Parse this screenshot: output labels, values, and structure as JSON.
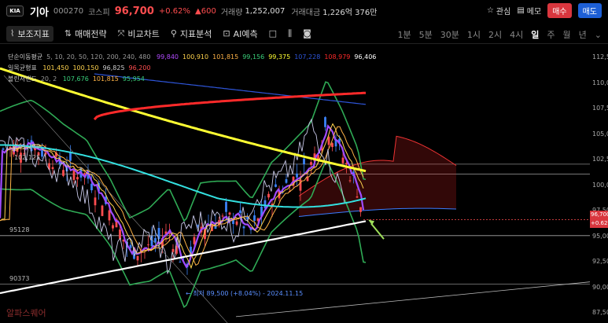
{
  "header": {
    "logo_text": "KIA",
    "name": "기아",
    "code": "000270",
    "market": "코스피",
    "price": "96,700",
    "change_pct": "+0.62%",
    "change_abs": "▲600",
    "volume_label": "거래량",
    "volume": "1,252,007",
    "amount_label": "거래대금",
    "amount": "1,226억 376만",
    "watch_label": "관심",
    "memo_label": "메모",
    "buy_label": "매수",
    "sell_label": "매도"
  },
  "toolbar": {
    "indicator_label": "보조지표",
    "strategy_label": "매매전략",
    "compare_label": "비교차트",
    "analysis_label": "지표분석",
    "ai_label": "AI예측"
  },
  "timeframes": [
    "1분",
    "5분",
    "30분",
    "1시",
    "2시",
    "4시",
    "일",
    "주",
    "월",
    "년"
  ],
  "active_timeframe": "일",
  "legend": {
    "ma_label": "단순이동평균",
    "ma_params": "5, 10, 20, 50, 120, 200, 240, 480",
    "ma_values": [
      {
        "v": "99,840",
        "c": "#b24bff"
      },
      {
        "v": "100,910",
        "c": "#ffd34d"
      },
      {
        "v": "101,815",
        "c": "#ffb347"
      },
      {
        "v": "99,156",
        "c": "#3ad07b"
      },
      {
        "v": "99,375",
        "c": "#ffff33"
      },
      {
        "v": "107,228",
        "c": "#2e55d9"
      },
      {
        "v": "108,979",
        "c": "#ff2a2a"
      },
      {
        "v": "96,406",
        "c": "#ffffff"
      }
    ],
    "ichimoku_label": "일목균형표",
    "ichimoku_values": [
      {
        "v": "101,450",
        "c": "#ffd34d"
      },
      {
        "v": "100,150",
        "c": "#ffd34d"
      },
      {
        "v": "96,825",
        "c": "#cccccc"
      },
      {
        "v": "96,200",
        "c": "#ff4d4f"
      }
    ],
    "bb_label": "볼린저밴드",
    "bb_params": "20, 2",
    "bb_values": [
      {
        "v": "107,676",
        "c": "#3ad07b"
      },
      {
        "v": "101,815",
        "c": "#ffb347"
      },
      {
        "v": "95,954",
        "c": "#3ad07b"
      }
    ]
  },
  "y_axis": [
    "112,500",
    "110,000",
    "107,500",
    "105,000",
    "102,500",
    "100,000",
    "97,500",
    "95,000",
    "92,500",
    "90,000",
    "87,500"
  ],
  "current_price_tag": "96,700",
  "current_pct_tag": "+0.62%",
  "levels": [
    "101,160",
    "102,125",
    "95128",
    "90373"
  ],
  "low_annotation": "← 최저 89,500 (+8.04%) - 2024.11.15",
  "watermark": "알파스퀘어",
  "colors": {
    "up": "#ff4d4f",
    "down": "#3b82f6",
    "accent": "#d9363e"
  }
}
